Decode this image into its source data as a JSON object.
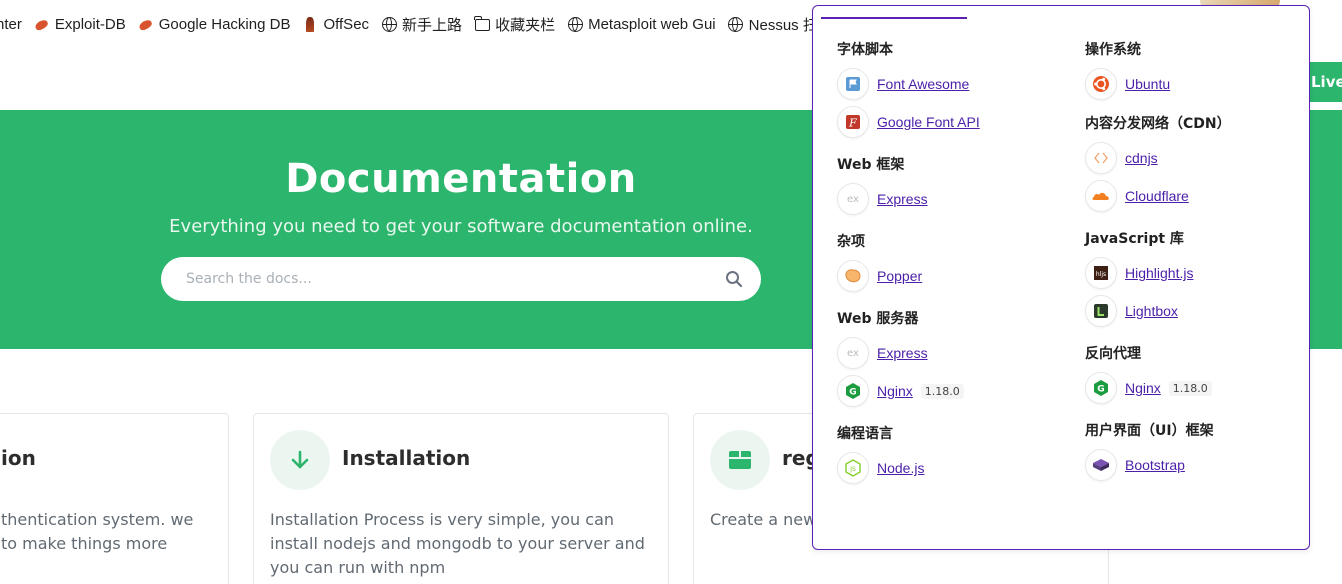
{
  "bookmarks": [
    {
      "label": "nter",
      "icon": "none"
    },
    {
      "label": "Exploit-DB",
      "icon": "bug-icon"
    },
    {
      "label": "Google Hacking DB",
      "icon": "bug-icon"
    },
    {
      "label": "OffSec",
      "icon": "offsec-icon"
    },
    {
      "label": "新手上路",
      "icon": "globe-icon"
    },
    {
      "label": "收藏夹栏",
      "icon": "folder-icon"
    },
    {
      "label": "Metasploit web Gui",
      "icon": "globe-icon"
    },
    {
      "label": "Nessus 扫描",
      "icon": "globe-icon"
    }
  ],
  "hero": {
    "title": "Documentation",
    "subtitle": "Everything you need to get your software documentation online.",
    "search_placeholder": "Search the docs...",
    "bg_color": "#2cb56d"
  },
  "live_button": "Live",
  "cards": [
    {
      "title": "ion",
      "body_lines": [
        "thentication system. we",
        " to make things more"
      ]
    },
    {
      "title": "Installation",
      "body_lines": [
        "Installation Process is very simple, you can",
        "install nodejs and mongodb to your server and",
        "you can run with npm"
      ],
      "icon": "arrow-down-icon"
    },
    {
      "title": "reg",
      "body_lines": [
        "Create a new"
      ],
      "icon": "box-icon"
    }
  ],
  "popover": {
    "accent_color": "#5b21b6",
    "left_sections": [
      {
        "title": "字体脚本",
        "items": [
          {
            "name": "Font Awesome",
            "icon": "flag-icon"
          },
          {
            "name": "Google Font API",
            "icon": "font-icon"
          }
        ]
      },
      {
        "title": "Web 框架",
        "items": [
          {
            "name": "Express",
            "icon": "express-icon"
          }
        ]
      },
      {
        "title": "杂项",
        "items": [
          {
            "name": "Popper",
            "icon": "popper-icon"
          }
        ]
      },
      {
        "title": "Web 服务器",
        "items": [
          {
            "name": "Express",
            "icon": "express-icon"
          },
          {
            "name": "Nginx",
            "icon": "nginx-icon",
            "version": "1.18.0"
          }
        ]
      },
      {
        "title": "编程语言",
        "items": [
          {
            "name": "Node.js",
            "icon": "nodejs-icon"
          }
        ]
      }
    ],
    "right_sections": [
      {
        "title": "操作系统",
        "items": [
          {
            "name": "Ubuntu",
            "icon": "ubuntu-icon"
          }
        ]
      },
      {
        "title": "内容分发网络（CDN）",
        "items": [
          {
            "name": "cdnjs",
            "icon": "cdnjs-icon"
          },
          {
            "name": "Cloudflare",
            "icon": "cloudflare-icon"
          }
        ]
      },
      {
        "title": "JavaScript 库",
        "items": [
          {
            "name": "Highlight.js",
            "icon": "highlightjs-icon"
          },
          {
            "name": "Lightbox",
            "icon": "lightbox-icon"
          }
        ]
      },
      {
        "title": "反向代理",
        "items": [
          {
            "name": "Nginx",
            "icon": "nginx-icon",
            "version": "1.18.0"
          }
        ]
      },
      {
        "title": "用户界面（UI）框架",
        "items": [
          {
            "name": "Bootstrap",
            "icon": "bootstrap-icon"
          }
        ]
      }
    ]
  }
}
